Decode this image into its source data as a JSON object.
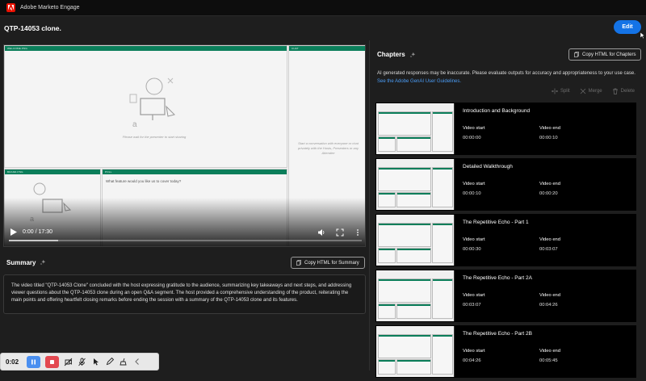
{
  "app": {
    "title": "Adobe Marketo Engage"
  },
  "header": {
    "page_title": "QTP-14053 clone.",
    "edit_label": "Edit"
  },
  "video": {
    "panes": {
      "welcome": "WELCOME.PNG",
      "chat": "CHAT",
      "brand": "BRAND.PNG",
      "poll": "POLL"
    },
    "welcome_text": "Please wait for the presenter to start sharing",
    "chat_text": "Start a conversation with everyone or chat privately with the Hosts, Presenters or any Attendee",
    "poll_question": "What feature would you like us to cover today?",
    "time": "0:00 / 17:30",
    "progress": 0.14
  },
  "summary": {
    "title": "Summary",
    "copy_label": "Copy HTML for Summary",
    "text": "The video titled \"QTP-14053 Clone\" concluded with the host expressing gratitude to the audience, summarizing key takeaways and next steps, and addressing viewer questions about the QTP-14053 clone during an open Q&A segment. The host provided a comprehensive understanding of the product, reiterating the main points and offering heartfelt closing remarks before ending the session with a summary of the QTP-14053 clone and its features."
  },
  "chapters": {
    "title": "Chapters",
    "copy_label": "Copy HTML for Chapters",
    "disclaimer": "AI generated responses may be inaccurate. Please evaluate outputs for accuracy and appropriateness to your use case.",
    "disclaimer_link": "See the Adobe GenAI User Guidelines.",
    "actions": {
      "split": "Split",
      "merge": "Merge",
      "delete": "Delete"
    },
    "start_label": "Video start",
    "end_label": "Video end",
    "items": [
      {
        "title": "Introduction and Background",
        "start": "00:00:00",
        "end": "00:00:10"
      },
      {
        "title": "Detailed Walkthrough",
        "start": "00:00:10",
        "end": "00:00:20"
      },
      {
        "title": "The Repetitive Echo - Part 1",
        "start": "00:00:30",
        "end": "00:03:07"
      },
      {
        "title": "The Repetitive Echo - Part 2A",
        "start": "00:03:07",
        "end": "00:04:26"
      },
      {
        "title": "The Repetitive Echo - Part 2B",
        "start": "00:04:26",
        "end": "00:05:45"
      }
    ]
  },
  "recorder": {
    "time": "0:02"
  },
  "colors": {
    "accent": "#1473e6",
    "pane_header": "#0b7e5a",
    "record": "#e34850"
  }
}
